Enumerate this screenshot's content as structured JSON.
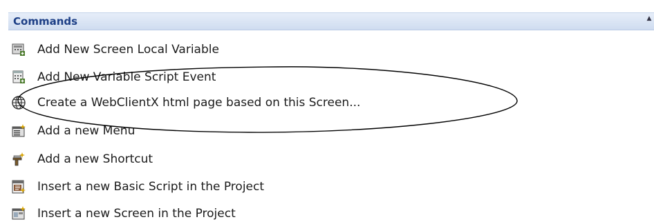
{
  "panel": {
    "title": "Commands",
    "collapse_glyph": "▲",
    "items": [
      {
        "label": "Add New Screen Local Variable",
        "icon": "screen-variable-icon"
      },
      {
        "label": "Add New Variable Script Event",
        "icon": "script-event-icon"
      },
      {
        "label": "Create a WebClientX html page based on this Screen...",
        "icon": "globe-icon"
      },
      {
        "label": "Add a new Menu",
        "icon": "menu-icon"
      },
      {
        "label": "Add a new Shortcut",
        "icon": "shortcut-icon"
      },
      {
        "label": "Insert a new Basic Script in the Project",
        "icon": "basic-script-icon"
      },
      {
        "label": "Insert a new Screen in the Project",
        "icon": "screen-icon"
      }
    ]
  },
  "colors": {
    "header_text": "#1d3f86",
    "header_bg": "#cfdcf0",
    "annotation_stroke": "#000000"
  }
}
